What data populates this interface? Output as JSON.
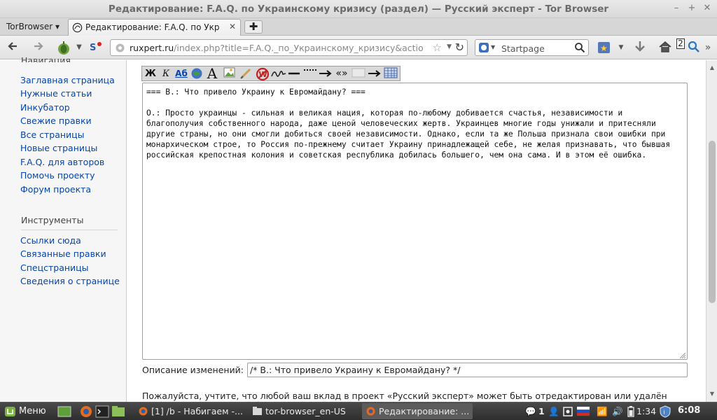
{
  "window": {
    "title": "Редактирование: F.A.Q. по Украинскому кризису (раздел) — Русский эксперт - Tor Browser"
  },
  "tabbar": {
    "app_menu": "TorBrowser ▾",
    "tab_label": "Редактирование: F.A.Q. по Украи...",
    "tab_close": "✕",
    "new_tab": "✚"
  },
  "navbar": {
    "url_host": "ruxpert.ru",
    "url_path": "/index.php?title=F.A.Q._по_Украинскому_кризису&action=",
    "search_placeholder": "Startpage",
    "badge_count": "2"
  },
  "sidebar": {
    "nav_heading": "Навигация",
    "nav_items": [
      "Заглавная страница",
      "Нужные статьи",
      "Инкубатор",
      "Свежие правки",
      "Все страницы",
      "Новые страницы",
      "F.A.Q. для авторов",
      "Помочь проекту",
      "Форум проекта"
    ],
    "tools_heading": "Инструменты",
    "tools_items": [
      "Ссылки сюда",
      "Связанные правки",
      "Спецстраницы",
      "Сведения о странице"
    ]
  },
  "editor": {
    "toolbar": [
      "Ж",
      "К",
      "Аб",
      "A"
    ],
    "text": "=== В.: Что привело Украину к Евромайдану? ===\n\nО.: Просто украинцы - сильная и великая нация, которая по-любому добивается счастья, независимости и благополучия собственного народа, даже ценой человеческих жертв. Украинцев многие годы унижали и притесняли другие страны, но они смогли добиться своей независимости. Однако, если та же Польша признала свои ошибки при монархическом строе, то Россия по-прежнему считает Украину принадлежащей себе, не желая признавать, что бывшая российская крепостная колония и советская республика добилась большего, чем она сама. И в этом её ошибка.",
    "summary_label": "Описание изменений:",
    "summary_value": "/* В.: Что привело Украину к Евромайдану? */",
    "notice": "Пожалуйста, учтите, что любой ваш вклад в проект «Русский эксперт» может быть отредактирован или удалён"
  },
  "taskbar": {
    "menu_label": "Меню",
    "tasks": [
      "[1] /b - Набигаем -...",
      "tor-browser_en-US",
      "Редактирование: ..."
    ],
    "workspace": "1",
    "battery_time": "1:34",
    "clock": "6:08"
  },
  "colors": {
    "link": "#0645ad",
    "taskbar": "#3a3a3a",
    "sidebar_bg": "#f6f6f6"
  }
}
